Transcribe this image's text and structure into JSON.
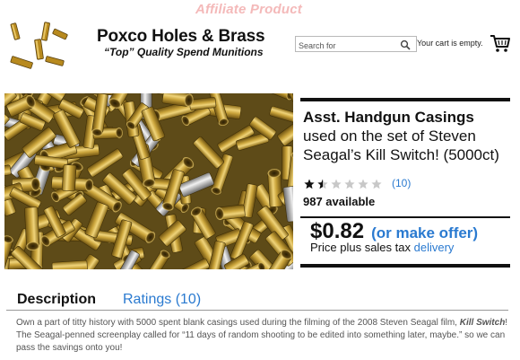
{
  "header": {
    "affiliate_label": "Affiliate Product",
    "brand_name": "Poxco Holes & Brass",
    "tagline": "“Top” Quality Spend Munitions",
    "search_placeholder": "Search for",
    "cart_status": "Your cart is empty."
  },
  "product": {
    "title_bold": "Asst. Handgun Casings",
    "title_rest": "used on the set of Steven Seagal’s Kill Switch! (5000ct)",
    "rating": 1.5,
    "rating_max": 5,
    "rating_count": "(10)",
    "available": "987 available",
    "price": "$0.82",
    "offer_label": "(or make offer)",
    "tax_text": "Price plus sales tax",
    "delivery_link": "delivery"
  },
  "tabs": {
    "description": "Description",
    "ratings": "Ratings (10)"
  },
  "description": {
    "part1": "Own a part of titty history with 5000 spent blank casings used during the filming of the 2008 Steven Seagal film, ",
    "film": "Kill Switch",
    "part2": "! The Seagal-penned screenplay called for “11 days of random shooting to be edited into something later, maybe.” so we can pass the savings onto you!"
  },
  "colors": {
    "link": "#2a7ad0",
    "affiliate": "#f4b9b9",
    "brass": "#c9a33a"
  },
  "icons": {
    "search": "magnifier",
    "cart": "shopping-cart",
    "star": "star"
  }
}
